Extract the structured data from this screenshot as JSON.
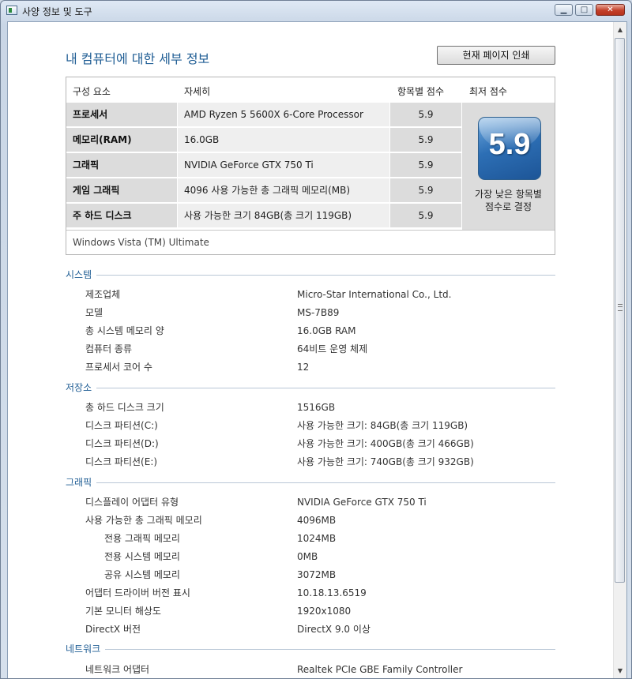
{
  "window": {
    "title": "사양 정보 및 도구"
  },
  "header": {
    "title": "내 컴퓨터에 대한 세부 정보",
    "print_button": "현재 페이지 인쇄"
  },
  "score_table": {
    "columns": {
      "component": "구성 요소",
      "details": "자세히",
      "subscore": "항목별 점수",
      "base_score": "최저 점수"
    },
    "rows": [
      {
        "component": "프로세서",
        "details": "AMD Ryzen 5 5600X 6-Core Processor",
        "subscore": "5.9"
      },
      {
        "component": "메모리(RAM)",
        "details": "16.0GB",
        "subscore": "5.9"
      },
      {
        "component": "그래픽",
        "details": "NVIDIA GeForce GTX 750 Ti",
        "subscore": "5.9"
      },
      {
        "component": "게임 그래픽",
        "details": "4096 사용 가능한 총 그래픽 메모리(MB)",
        "subscore": "5.9"
      },
      {
        "component": "주 하드 디스크",
        "details": "사용 가능한 크기 84GB(총 크기 119GB)",
        "subscore": "5.9"
      }
    ],
    "base_score": {
      "value": "5.9",
      "caption_line1": "가장 낮은 항목별",
      "caption_line2": "점수로 결정"
    },
    "footer": "Windows Vista (TM) Ultimate"
  },
  "sections": {
    "system": {
      "title": "시스템",
      "rows": [
        {
          "label": "제조업체",
          "value": "Micro-Star International Co., Ltd."
        },
        {
          "label": "모델",
          "value": "MS-7B89"
        },
        {
          "label": "총 시스템 메모리 양",
          "value": "16.0GB RAM"
        },
        {
          "label": "컴퓨터 종류",
          "value": "64비트 운영 체제"
        },
        {
          "label": "프로세서 코어 수",
          "value": "12"
        }
      ]
    },
    "storage": {
      "title": "저장소",
      "rows": [
        {
          "label": "총 하드 디스크 크기",
          "value": "1516GB"
        },
        {
          "label": "디스크 파티션(C:)",
          "value": "사용 가능한 크기: 84GB(총 크기 119GB)"
        },
        {
          "label": "디스크 파티션(D:)",
          "value": "사용 가능한 크기: 400GB(총 크기 466GB)"
        },
        {
          "label": "디스크 파티션(E:)",
          "value": "사용 가능한 크기: 740GB(총 크기 932GB)"
        }
      ]
    },
    "graphics": {
      "title": "그래픽",
      "rows": [
        {
          "label": "디스플레이 어댑터 유형",
          "value": "NVIDIA GeForce GTX 750 Ti"
        },
        {
          "label": "사용 가능한 총 그래픽 메모리",
          "value": "4096MB"
        },
        {
          "label": "전용 그래픽 메모리",
          "value": "1024MB"
        },
        {
          "label": "전용 시스템 메모리",
          "value": "0MB"
        },
        {
          "label": "공유 시스템 메모리",
          "value": "3072MB"
        },
        {
          "label": "어댑터 드라이버 버전 표시",
          "value": "10.18.13.6519"
        },
        {
          "label": "기본 모니터 해상도",
          "value": "1920x1080"
        },
        {
          "label": "DirectX 버전",
          "value": "DirectX 9.0 이상"
        }
      ]
    },
    "network": {
      "title": "네트워크",
      "rows": [
        {
          "label": "네트워크 어댑터",
          "value": "Realtek PCIe GBE Family Controller"
        }
      ]
    }
  },
  "scrollbar": {
    "up_glyph": "▲",
    "down_glyph": "▼"
  },
  "colors": {
    "section_title": "#1f5d94",
    "badge": "#2d6fb5"
  },
  "icons": [
    "app-icon",
    "minimize-icon",
    "maximize-icon",
    "close-icon",
    "score-badge-icon"
  ]
}
